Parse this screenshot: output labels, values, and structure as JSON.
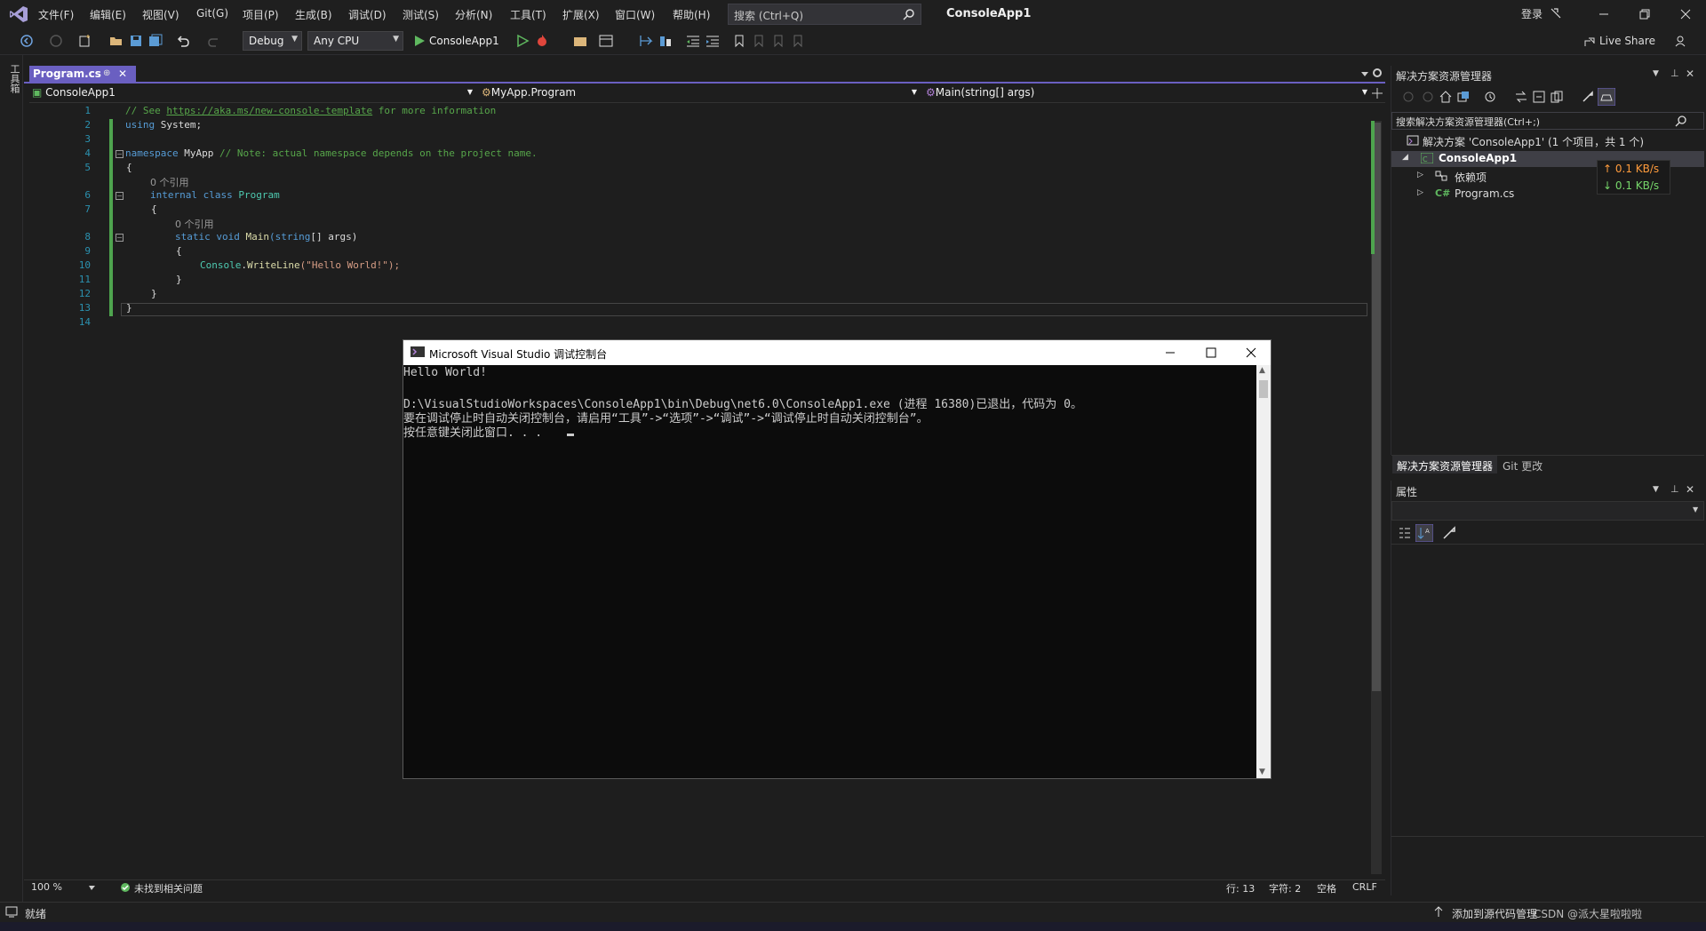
{
  "menubar": {
    "items": [
      "文件(F)",
      "编辑(E)",
      "视图(V)",
      "Git(G)",
      "项目(P)",
      "生成(B)",
      "调试(D)",
      "测试(S)",
      "分析(N)",
      "工具(T)",
      "扩展(X)",
      "窗口(W)",
      "帮助(H)"
    ],
    "search_placeholder": "搜索 (Ctrl+Q)",
    "title": "ConsoleApp1",
    "login": "登录"
  },
  "toolbar": {
    "config": "Debug",
    "platform": "Any CPU",
    "run_label": "ConsoleApp1",
    "live_share": "Live Share"
  },
  "toolbox": {
    "label": "工具箱"
  },
  "editor": {
    "tab": "Program.cs",
    "nav_project": "ConsoleApp1",
    "nav_class": "MyApp.Program",
    "nav_member": "Main(string[] args)",
    "line_numbers": [
      "1",
      "2",
      "3",
      "4",
      "5",
      "",
      "6",
      "7",
      "",
      "8",
      "9",
      "10",
      "11",
      "12",
      "13",
      "14"
    ],
    "comment1_pre": "// See ",
    "comment1_link": "https://aka.ms/new-console-template",
    "comment1_post": " for more information",
    "using_kw": "using",
    "using_rest": " System;",
    "ns_kw": "namespace",
    "ns_name": " MyApp ",
    "ns_comment": "// Note: actual namespace depends on the project name.",
    "brace_open": "{",
    "brace_close": "}",
    "refs1": "0 个引用",
    "class_kw": "internal class",
    "class_name": " Program",
    "refs2": "0 个引用",
    "main_kw": "static void",
    "main_name": " Main",
    "main_args_kw": "(string",
    "main_args_rest": "[] args)",
    "console_cls": "Console",
    "console_dot": ".",
    "console_meth": "WriteLine",
    "console_str": "(\"Hello World!\");",
    "status": {
      "zoom": "100 %",
      "issues": "未找到相关问题",
      "line": "行: 13",
      "char": "字符: 2",
      "space": "空格",
      "crlf": "CRLF"
    }
  },
  "console": {
    "title": "Microsoft Visual Studio 调试控制台",
    "lines": [
      "Hello World!",
      "",
      "D:\\VisualStudioWorkspaces\\ConsoleApp1\\bin\\Debug\\net6.0\\ConsoleApp1.exe (进程 16380)已退出，代码为 0。",
      "要在调试停止时自动关闭控制台，请启用“工具”->“选项”->“调试”->“调试停止时自动关闭控制台”。",
      "按任意键关闭此窗口. . ."
    ]
  },
  "solution_explorer": {
    "title": "解决方案资源管理器",
    "search_placeholder": "搜索解决方案资源管理器(Ctrl+;)",
    "solution": "解决方案 'ConsoleApp1' (1 个项目，共 1 个)",
    "project": "ConsoleApp1",
    "deps": "依赖项",
    "file": "Program.cs",
    "upload": "↑ 0.1 KB/s",
    "download": "↓ 0.1 KB/s",
    "tab_active": "解决方案资源管理器",
    "tab_git": "Git 更改"
  },
  "properties": {
    "title": "属性"
  },
  "statusbar": {
    "ready": "就绪",
    "source_control": "添加到源代码管理",
    "watermark": "CSDN @派大星啦啦啦"
  },
  "colors": {
    "accent": "#6a5fc1",
    "change_bar": "#4ea44e",
    "upload": "#ff9b3c",
    "download": "#76d66a"
  }
}
